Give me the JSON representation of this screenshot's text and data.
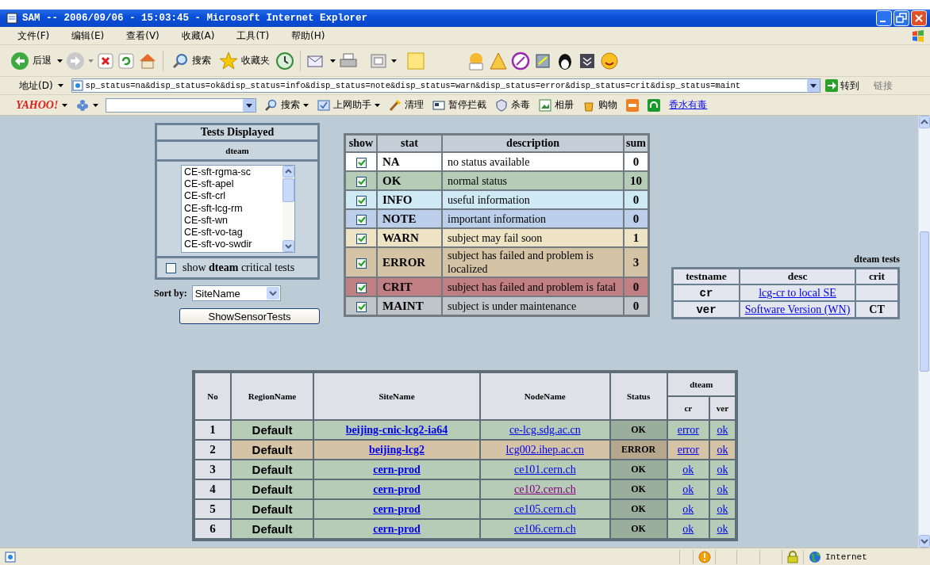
{
  "window": {
    "title": "SAM -- 2006/09/06 - 15:03:45 - Microsoft Internet Explorer"
  },
  "menu": [
    "文件(F)",
    "编辑(E)",
    "查看(V)",
    "收藏(A)",
    "工具(T)",
    "帮助(H)"
  ],
  "toolbar": {
    "back": "后退",
    "search": "搜索",
    "favorites": "收藏夹"
  },
  "address_bar": {
    "label": "地址(D)",
    "url": "sp_status=na&disp_status=ok&disp_status=info&disp_status=note&disp_status=warn&disp_status=error&disp_status=crit&disp_status=maint",
    "go": "转到",
    "links": "链接"
  },
  "yahoo_bar": {
    "logo": "YAHOO!",
    "search": "搜索",
    "items": [
      {
        "label": "上网助手",
        "kind": "menu"
      },
      {
        "label": "清理",
        "kind": "button"
      },
      {
        "label": "暂停拦截",
        "kind": "button"
      },
      {
        "label": "杀毒",
        "kind": "button"
      },
      {
        "label": "相册",
        "kind": "button"
      },
      {
        "label": "购物",
        "kind": "button"
      },
      {
        "label": "香水有毒",
        "kind": "link"
      }
    ]
  },
  "tests_panel": {
    "title": "Tests Displayed",
    "vo": "dteam",
    "tests": [
      "CE-sft-rgma-sc",
      "CE-sft-apel",
      "CE-sft-crl",
      "CE-sft-lcg-rm",
      "CE-sft-wn",
      "CE-sft-vo-tag",
      "CE-sft-vo-swdir"
    ],
    "critical_checkbox": {
      "label": "show **dteam** critical tests",
      "checked": false
    },
    "sort_by": {
      "label": "Sort by:",
      "value": "SiteName"
    },
    "button": "ShowSensorTests"
  },
  "status_table": {
    "columns": [
      "show",
      "stat",
      "description",
      "sum"
    ],
    "rows": [
      {
        "show": true,
        "stat": "NA",
        "description": "no status available",
        "sum": "0",
        "color": "#ffffff"
      },
      {
        "show": true,
        "stat": "OK",
        "description": "normal status",
        "sum": "10",
        "color": "#b6ccb6"
      },
      {
        "show": true,
        "stat": "INFO",
        "description": "useful information",
        "sum": "0",
        "color": "#cfe9f5"
      },
      {
        "show": true,
        "stat": "NOTE",
        "description": "important information",
        "sum": "0",
        "color": "#bccfea"
      },
      {
        "show": true,
        "stat": "WARN",
        "description": "subject may fail soon",
        "sum": "1",
        "color": "#efe3c6"
      },
      {
        "show": true,
        "stat": "ERROR",
        "description": "subject has failed and problem is localized",
        "sum": "3",
        "color": "#d5c3a5"
      },
      {
        "show": true,
        "stat": "CRIT",
        "description": "subject has failed and problem is fatal",
        "sum": "0",
        "color": "#c07f82"
      },
      {
        "show": true,
        "stat": "MAINT",
        "description": "subject is under maintenance",
        "sum": "0",
        "color": "#c0c5c9"
      }
    ]
  },
  "tests_table": {
    "caption": "dteam tests",
    "columns": [
      "testname",
      "desc",
      "crit"
    ],
    "rows": [
      {
        "testname": "cr",
        "desc": "lcg-cr to local SE"
      },
      {
        "testname": "ver",
        "desc": "Software Version (WN)",
        "crit": "CT"
      }
    ]
  },
  "sites_table": {
    "columns": [
      "No",
      "RegionName",
      "SiteName",
      "NodeName",
      "Status"
    ],
    "group": "dteam",
    "sub_columns": [
      "cr",
      "ver"
    ],
    "rows": [
      {
        "no": "1",
        "region": "Default",
        "site": "beijing-cnic-lcg2-ia64",
        "node": "ce-lcg.sdg.ac.cn",
        "node_visited": false,
        "status": "OK",
        "color": "#b6ccb6",
        "tests": [
          "error",
          "ok"
        ]
      },
      {
        "no": "2",
        "region": "Default",
        "site": "beijing-lcg2",
        "node": "lcg002.ihep.ac.cn",
        "node_visited": false,
        "status": "ERROR",
        "color": "#d5c3a5",
        "tests": [
          "error",
          "ok"
        ]
      },
      {
        "no": "3",
        "region": "Default",
        "site": "cern-prod",
        "node": "ce101.cern.ch",
        "node_visited": false,
        "status": "OK",
        "color": "#b6ccb6",
        "tests": [
          "ok",
          "ok"
        ]
      },
      {
        "no": "4",
        "region": "Default",
        "site": "cern-prod",
        "node": "ce102.cern.ch",
        "node_visited": true,
        "status": "OK",
        "color": "#b6ccb6",
        "tests": [
          "ok",
          "ok"
        ]
      },
      {
        "no": "5",
        "region": "Default",
        "site": "cern-prod",
        "node": "ce105.cern.ch",
        "node_visited": false,
        "status": "OK",
        "color": "#b6ccb6",
        "tests": [
          "ok",
          "ok"
        ]
      },
      {
        "no": "6",
        "region": "Default",
        "site": "cern-prod",
        "node": "ce106.cern.ch",
        "node_visited": false,
        "status": "OK",
        "color": "#b6ccb6",
        "tests": [
          "ok",
          "ok"
        ]
      }
    ]
  },
  "status_bar": {
    "zone": "Internet"
  }
}
